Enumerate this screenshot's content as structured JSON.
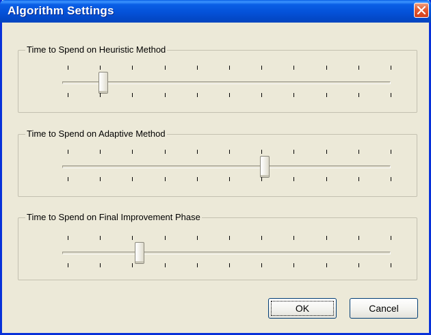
{
  "window": {
    "title": "Algorithm Settings"
  },
  "groups": [
    {
      "label": "Time to Spend on Heuristic Method",
      "value_fraction": 0.111
    },
    {
      "label": "Time to Spend on Adaptive Method",
      "value_fraction": 0.611
    },
    {
      "label": "Time to Spend on Final Improvement Phase",
      "value_fraction": 0.222
    }
  ],
  "slider": {
    "tick_count": 11
  },
  "buttons": {
    "ok_label": "OK",
    "cancel_label": "Cancel"
  },
  "colors": {
    "title_bar": "#0a5fe6",
    "dialog_bg": "#ece9d8",
    "close_button": "#e35b32",
    "button_border": "#003c74"
  },
  "icons": {
    "close": "close-icon"
  }
}
